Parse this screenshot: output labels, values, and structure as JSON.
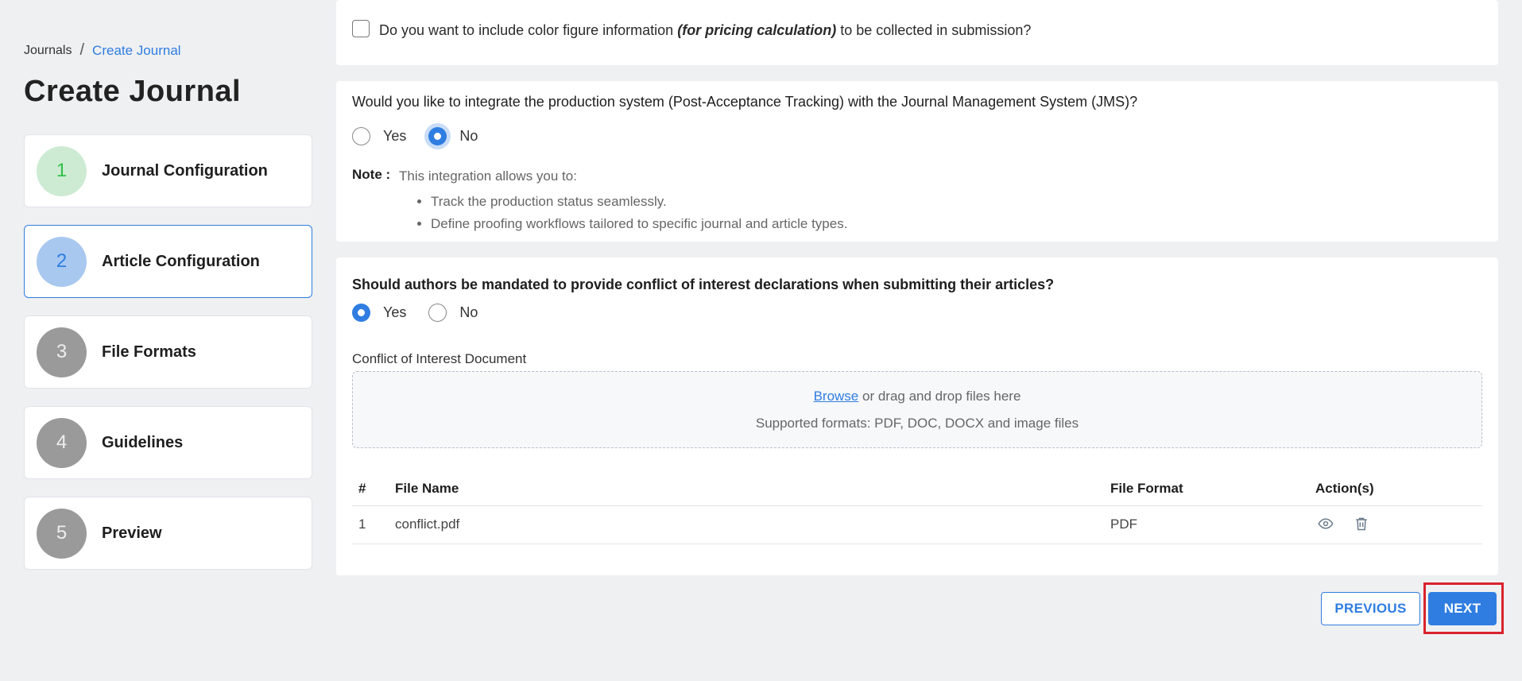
{
  "breadcrumb": {
    "root": "Journals",
    "separator": "/",
    "current": "Create Journal"
  },
  "page_title": "Create Journal",
  "steps": [
    {
      "number": "1",
      "label": "Journal Configuration",
      "state": "done"
    },
    {
      "number": "2",
      "label": "Article Configuration",
      "state": "current"
    },
    {
      "number": "3",
      "label": "File Formats",
      "state": "pending"
    },
    {
      "number": "4",
      "label": "Guidelines",
      "state": "pending"
    },
    {
      "number": "5",
      "label": "Preview",
      "state": "pending"
    }
  ],
  "color_figure": {
    "text_before": "Do you want to include color figure information",
    "emphasis": "(for pricing calculation)",
    "text_after": "to be collected in submission?",
    "checked": false
  },
  "production": {
    "question": "Would you like to integrate the production system (Post-Acceptance Tracking) with the Journal Management System (JMS)?",
    "yes_label": "Yes",
    "no_label": "No",
    "selected": "No",
    "note_label": "Note :",
    "note_text": "This integration allows you to:",
    "note_items": [
      "Track the production status seamlessly.",
      "Define proofing workflows tailored to specific journal and article types."
    ]
  },
  "conflict": {
    "question": "Should authors be mandated to provide conflict of interest declarations when submitting their articles?",
    "yes_label": "Yes",
    "no_label": "No",
    "selected": "Yes",
    "document_label": "Conflict of Interest Document",
    "browse_label": "Browse",
    "drop_text": "or drag and drop files here",
    "formats_text": "Supported formats: PDF, DOC, DOCX and image files",
    "table": {
      "headers": [
        "#",
        "File Name",
        "File Format",
        "Action(s)"
      ],
      "rows": [
        {
          "index": "1",
          "name": "conflict.pdf",
          "format": "PDF"
        }
      ]
    }
  },
  "footer": {
    "previous_label": "PREVIOUS",
    "next_label": "NEXT"
  },
  "colors": {
    "accent": "#2f7de1",
    "highlight": "#d9232d",
    "step_done": "#2fbf4a"
  },
  "icons": {
    "view": "eye-icon",
    "delete": "trash-icon"
  }
}
